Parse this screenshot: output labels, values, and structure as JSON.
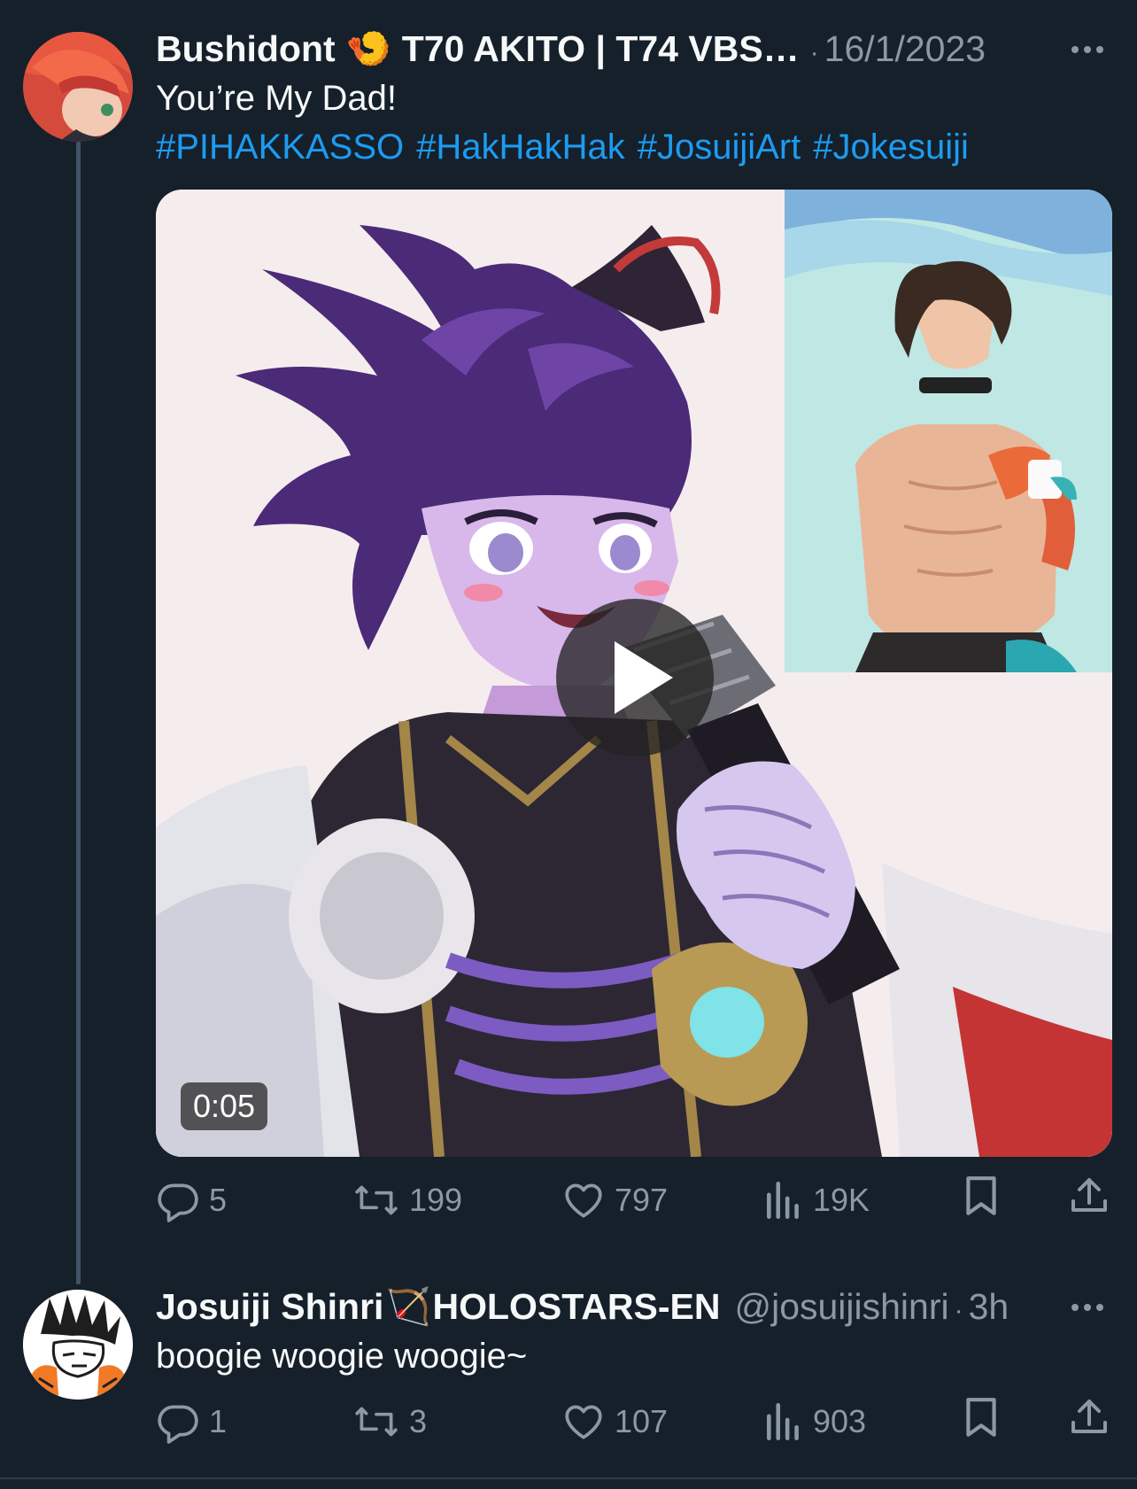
{
  "tweets": [
    {
      "display_name": "Bushidont",
      "emoji": "🍤",
      "name_suffix": "T70 AKITO | T74 VBS…",
      "separator": "·",
      "handle": "",
      "time": "16/1/2023",
      "text": "You’re My Dad!",
      "hashtags": [
        "#PIHAKKASSO",
        "#HakHakHak",
        "#JosuijiArt",
        "#Jokesuiji"
      ],
      "video_duration": "0:05",
      "stats": {
        "replies": "5",
        "reposts": "199",
        "likes": "797",
        "views": "19K"
      }
    },
    {
      "display_name": "Josuiji Shinri",
      "emoji": "🏹",
      "name_suffix": "HOLOSTARS-EN",
      "handle": "@josuijishinri",
      "separator": "·",
      "time": "3h",
      "text": "boogie woogie woogie~",
      "stats": {
        "replies": "1",
        "reposts": "3",
        "likes": "107",
        "views": "903"
      }
    }
  ],
  "colors": {
    "background": "#15202b",
    "text": "#f7f9f9",
    "muted": "#8b98a5",
    "link": "#1d9bf0",
    "thread_line": "#425466"
  },
  "icons": [
    "more-icon",
    "reply-icon",
    "repost-icon",
    "like-icon",
    "views-icon",
    "bookmark-icon",
    "share-icon",
    "play-icon"
  ]
}
